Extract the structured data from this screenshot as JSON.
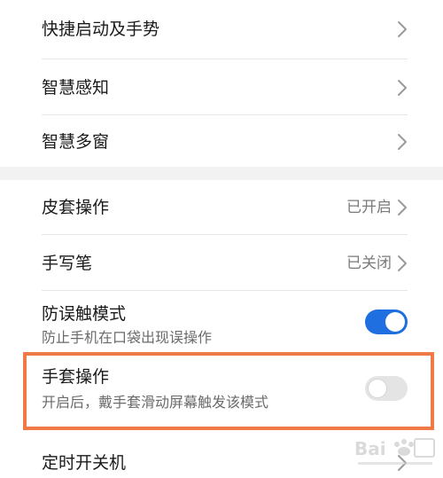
{
  "top_section": {
    "items": [
      {
        "title": "快捷启动及手势"
      },
      {
        "title": "智慧感知"
      },
      {
        "title": "智慧多窗"
      }
    ]
  },
  "bottom_section": {
    "cover": {
      "title": "皮套操作",
      "status": "已开启"
    },
    "stylus": {
      "title": "手写笔",
      "status": "已关闭"
    },
    "pocket_mode": {
      "title": "防误触模式",
      "subtitle": "防止手机在口袋出现误操作",
      "enabled": true
    },
    "glove_mode": {
      "title": "手套操作",
      "subtitle": "开启后，戴手套滑动屏幕触发该模式",
      "enabled": false
    },
    "scheduled_power": {
      "title": "定时开关机"
    }
  },
  "colors": {
    "toggle_on": "#1f6fe0",
    "toggle_off": "#e4e4e4",
    "highlight": "#f07a45"
  }
}
